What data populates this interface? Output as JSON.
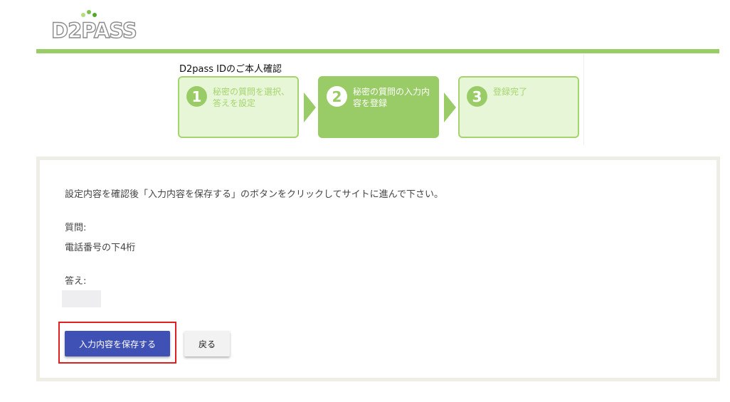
{
  "logo": {
    "text": "D2PASS",
    "dot_colors": [
      "#b5dd7a",
      "#7cc24a",
      "#4ea82a"
    ]
  },
  "steps": {
    "title": "D2pass IDのご本人確認",
    "items": [
      {
        "number": "1",
        "label": "秘密の質問を選択、答えを設定",
        "state": "inactive"
      },
      {
        "number": "2",
        "label": "秘密の質問の入力内容を登録",
        "state": "active"
      },
      {
        "number": "3",
        "label": "登録完了",
        "state": "inactive"
      }
    ]
  },
  "main": {
    "instruction": "設定内容を確認後「入力内容を保存する」のボタンをクリックしてサイトに進んで下さい。",
    "question_label": "質問:",
    "question_value": "電話番号の下4桁",
    "answer_label": "答え:",
    "answer_value": ""
  },
  "buttons": {
    "save_label": "入力内容を保存する",
    "back_label": "戻る"
  },
  "colors": {
    "accent_green": "#99cc66",
    "primary_button": "#3f51b5",
    "highlight_border": "#e02020"
  }
}
